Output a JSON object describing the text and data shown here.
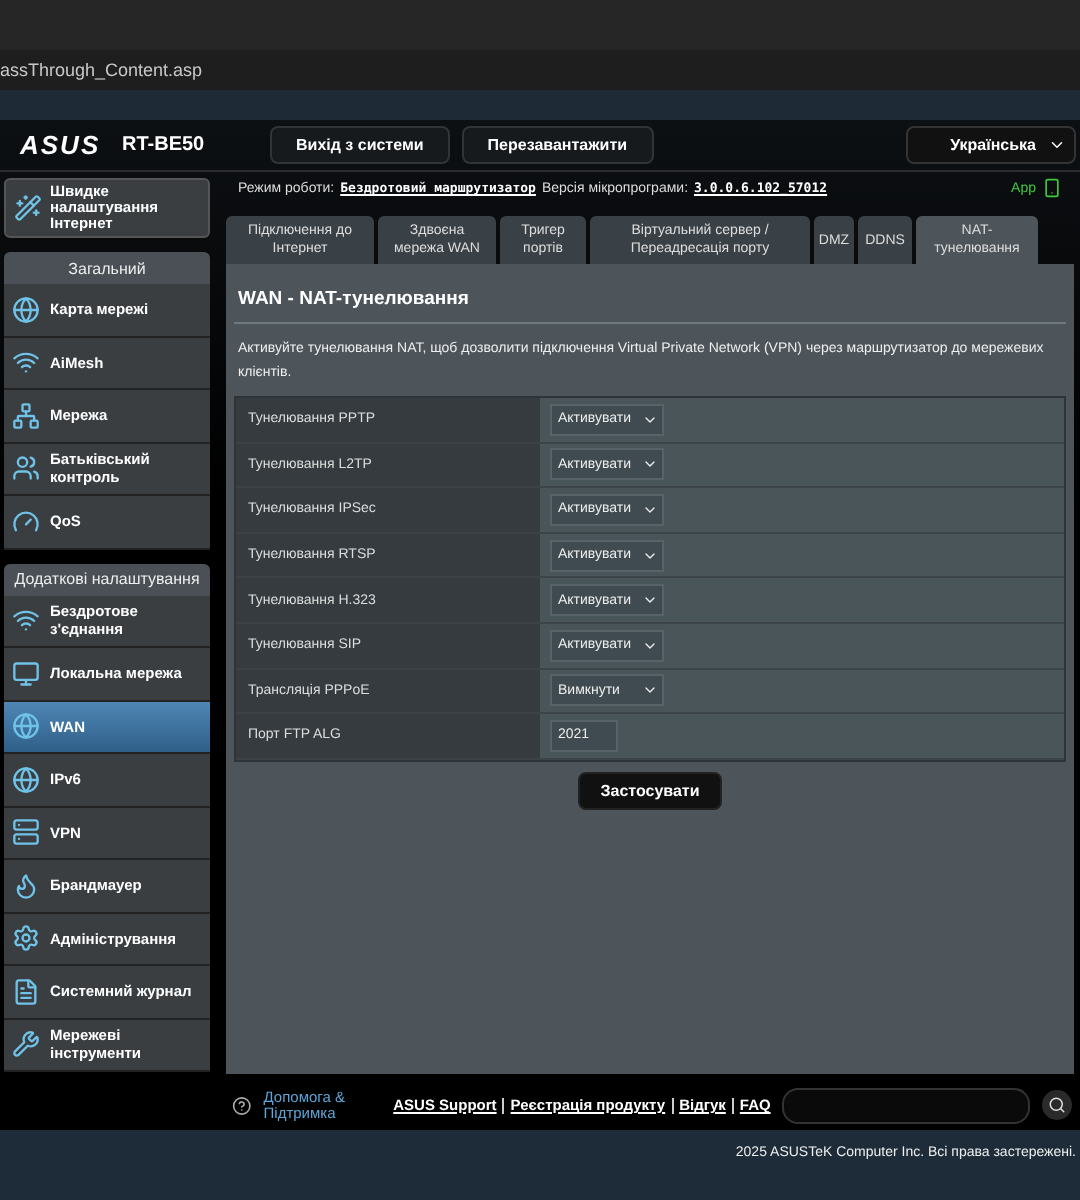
{
  "browser": {
    "url": "assThrough_Content.asp"
  },
  "header": {
    "logo": "ASUS",
    "model": "RT-BE50",
    "buttons": [
      "Вихід з системи",
      "Перезавантажити"
    ],
    "language": "Українська"
  },
  "sidebar": {
    "quick_setup": "Швидке налаштування Інтернет",
    "sections": [
      {
        "title": "Загальний",
        "items": [
          {
            "label": "Карта мережі",
            "kind": "map",
            "selected": false
          },
          {
            "label": "AiMesh",
            "kind": "mesh",
            "selected": false
          },
          {
            "label": "Мережа",
            "kind": "network",
            "selected": false
          },
          {
            "label": "Батьківський контроль",
            "kind": "parental",
            "selected": false
          },
          {
            "label": "QoS",
            "kind": "qos",
            "selected": false
          }
        ]
      },
      {
        "title": "Додаткові налаштування",
        "items": [
          {
            "label": "Бездротове з'єднання",
            "kind": "wireless",
            "selected": false
          },
          {
            "label": "Локальна мережа",
            "kind": "lan",
            "selected": false
          },
          {
            "label": "WAN",
            "kind": "wan",
            "selected": true
          },
          {
            "label": "IPv6",
            "kind": "ipv6",
            "selected": false
          },
          {
            "label": "VPN",
            "kind": "vpn",
            "selected": false
          },
          {
            "label": "Брандмауер",
            "kind": "firewall",
            "selected": false
          },
          {
            "label": "Адміністрування",
            "kind": "admin",
            "selected": false
          },
          {
            "label": "Системний журнал",
            "kind": "log",
            "selected": false
          },
          {
            "label": "Мережеві інструменти",
            "kind": "tools",
            "selected": false
          }
        ]
      }
    ]
  },
  "status": {
    "mode_label": "Режим роботи:",
    "mode": "Бездротовий маршрутизатор",
    "firmware_label": "Версія мікропрограми:",
    "firmware": "3.0.0.6.102_57012",
    "app": "App"
  },
  "tabs": [
    {
      "label": "Підключення до Інтернет",
      "selected": false
    },
    {
      "label": "Здвоєна мережа WAN",
      "selected": false
    },
    {
      "label": "Тригер портів",
      "selected": false
    },
    {
      "label": "Віртуальний сервер / Переадресація порту",
      "selected": false
    },
    {
      "label": "DMZ",
      "selected": false
    },
    {
      "label": "DDNS",
      "selected": false
    },
    {
      "label": "NAT-тунелювання",
      "selected": true
    }
  ],
  "panel": {
    "title": "WAN - NAT-тунелювання",
    "description": "Активуйте тунелювання NAT, щоб дозволити підключення Virtual Private Network (VPN) через маршрутизатор до мережевих клієнтів.",
    "rows": [
      {
        "label": "Тунелювання PPTP",
        "kind": "select",
        "value": "Активувати"
      },
      {
        "label": "Тунелювання L2TP",
        "kind": "select",
        "value": "Активувати"
      },
      {
        "label": "Тунелювання IPSec",
        "kind": "select",
        "value": "Активувати"
      },
      {
        "label": "Тунелювання RTSP",
        "kind": "select",
        "value": "Активувати"
      },
      {
        "label": "Тунелювання H.323",
        "kind": "select",
        "value": "Активувати"
      },
      {
        "label": "Тунелювання SIP",
        "kind": "select",
        "value": "Активувати"
      },
      {
        "label": "Трансляція PPPoE",
        "kind": "select",
        "value": "Вимкнути"
      },
      {
        "label": "Порт FTP ALG",
        "kind": "input",
        "value": "2021"
      }
    ],
    "apply": "Застосувати"
  },
  "footer": {
    "help": "Допомога & Підтримка",
    "links": [
      "ASUS Support",
      "Реєстрація продукту",
      "Відгук",
      "FAQ"
    ],
    "copyright": "2025 ASUSTeK Computer Inc. Всі права застережені."
  }
}
